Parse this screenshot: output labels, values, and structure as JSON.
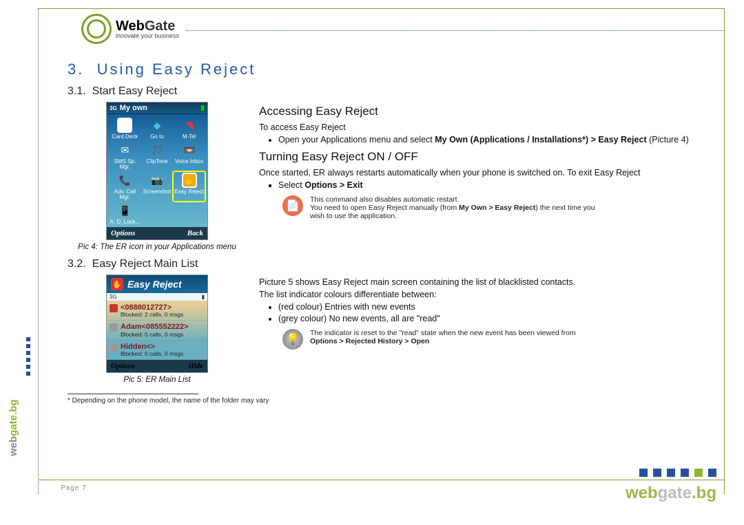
{
  "brand": {
    "name_web": "Web",
    "name_gate": "Gate",
    "tagline": "innovate your business"
  },
  "section": {
    "num": "3.",
    "title": "Using Easy Reject"
  },
  "sub1": {
    "num": "3.1.",
    "title": "Start Easy Reject"
  },
  "sub2": {
    "num": "3.2.",
    "title": "Easy Reject Main List"
  },
  "access": {
    "heading": "Accessing Easy Reject",
    "lead": "To access Easy Reject",
    "bullet_pre": "Open your Applications menu and select ",
    "bullet_bold": "My Own (Applications / Installations*) > Easy Reject",
    "bullet_post": " (Picture 4)"
  },
  "turning": {
    "heading": "Turning Easy Reject ON / OFF",
    "p1": "Once started, ER always restarts automatically when your phone is switched on. To exit Easy Reject",
    "li_pre": "Select ",
    "li_bold": "Options > Exit",
    "tip1a": "This command also disables automatic restart.",
    "tip1b_pre": "You need to open Easy Reject manually (from ",
    "tip1b_bold": "My Own > Easy Reject",
    "tip1b_post": ") the next time you wish to use the application."
  },
  "mainlist": {
    "p1": "Picture 5 shows Easy Reject main screen containing the list of blacklisted contacts.",
    "p2": "The list indicator colours differentiate between:",
    "li1": "(red colour) Entries with new events",
    "li2": "(grey colour) No new events, all are \"read\"",
    "tip_pre": "The indicator is reset to the \"read\" state when the new event has been viewed from ",
    "tip_bold": "Options > Rejected History > Open"
  },
  "phone1": {
    "title": "My own",
    "apps": [
      "Card Deck",
      "Go to",
      "M-Tel",
      "SMS Sp. Mgr.",
      "ClipTone",
      "Voice Inbox",
      "Adv. Call Mgr.",
      "Screenshot",
      "Easy Reject",
      "A. D. Lock..."
    ],
    "soft_left": "Options",
    "soft_right": "Back",
    "caption": "Pic 4: The ER icon in your Applications menu"
  },
  "phone2": {
    "title": "Easy Reject",
    "status_left": "3G",
    "entries": [
      {
        "num": "<0888012727>",
        "sub": "Blocked: 2 calls, 0 msgs",
        "color": "red"
      },
      {
        "num": "Adam<085552222>",
        "sub": "Blocked: 0 calls, 0 msgs",
        "color": "grey"
      },
      {
        "num": "Hidden<>",
        "sub": "Blocked: 0 calls, 0 msgs",
        "color": "grey"
      }
    ],
    "soft_left": "Options",
    "soft_right": "Hide",
    "caption": "Pic 5: ER Main List"
  },
  "footnote": "Depending on the phone model, the name of the folder may vary",
  "page_label": "Page 7",
  "footer": {
    "web": "web",
    "gate": "gate",
    "bg": ".bg"
  },
  "side": {
    "web": "web",
    "gate": "gate",
    "bg": ".bg"
  }
}
